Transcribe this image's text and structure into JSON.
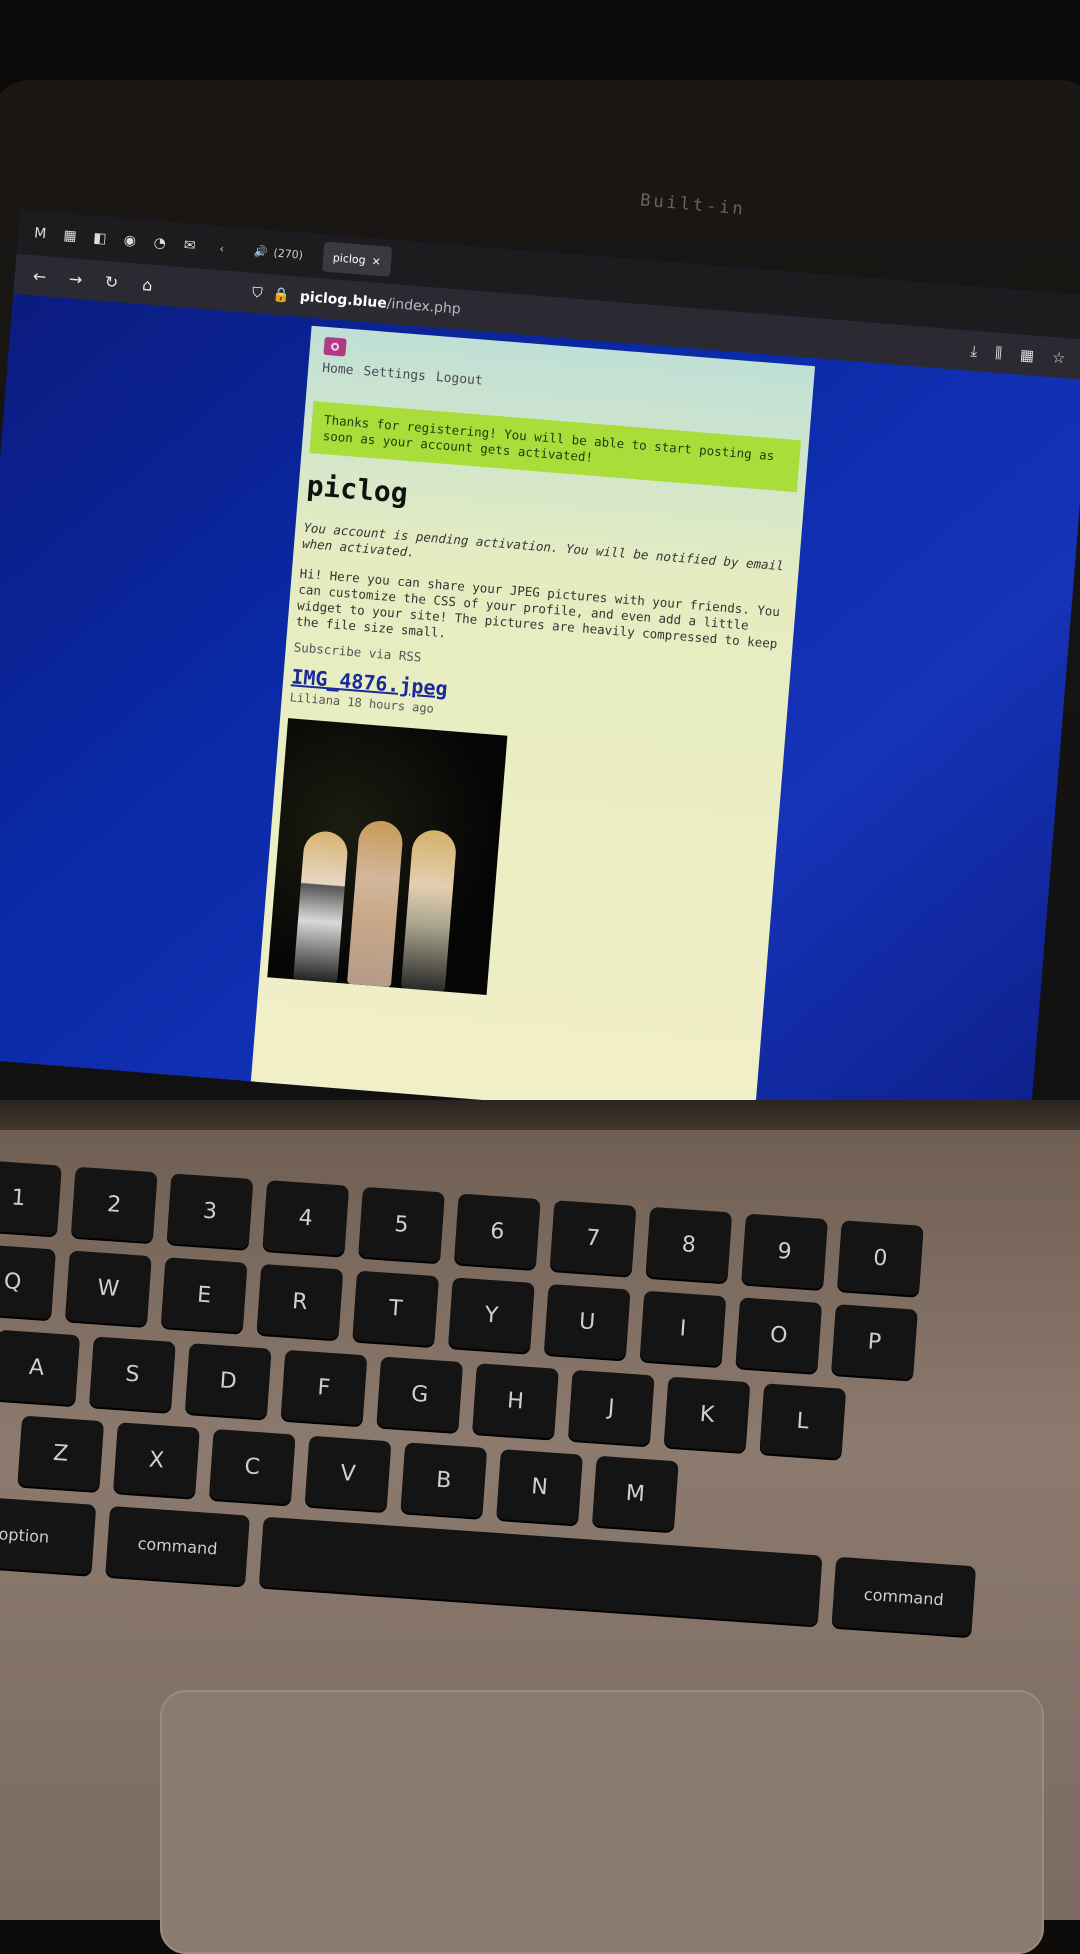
{
  "device": {
    "camera_label": "Built-in"
  },
  "browser": {
    "tabs": [
      "(270)",
      "piclog"
    ],
    "active_tab": "piclog",
    "url_host": "piclog.blue",
    "url_path": "/index.php"
  },
  "page": {
    "nav": [
      "Home",
      "Settings",
      "Logout"
    ],
    "notice": "Thanks for registering! You will be able to start posting as soon as your account gets activated!",
    "title": "piclog",
    "pending": "You account is pending activation. You will be notified by email when activated.",
    "intro": "Hi! Here you can share your JPEG pictures with your friends. You can customize the CSS of your profile, and even add a little widget to your site! The pictures are heavily compressed to keep the file size small.",
    "subscribe": "Subscribe via RSS",
    "post": {
      "title": "IMG_4876.jpeg",
      "meta": "Liliana 18 hours ago"
    }
  },
  "keyboard": {
    "row_numbers": [
      "1",
      "2",
      "3",
      "4",
      "5",
      "6",
      "7",
      "8",
      "9",
      "0"
    ],
    "row_qwerty": [
      "Q",
      "W",
      "E",
      "R",
      "T",
      "Y",
      "U",
      "I",
      "O",
      "P"
    ],
    "row_asdf": [
      "A",
      "S",
      "D",
      "F",
      "G",
      "H",
      "J",
      "K",
      "L"
    ],
    "row_zxcv": [
      "Z",
      "X",
      "C",
      "V",
      "B",
      "N",
      "M"
    ],
    "modifiers": {
      "option": "option",
      "command": "command"
    }
  }
}
